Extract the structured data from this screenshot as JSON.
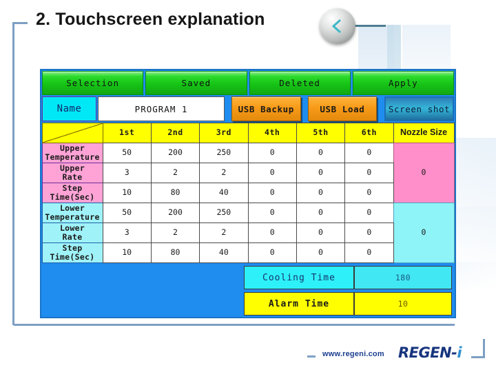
{
  "slide": {
    "title": "2. Touchscreen explanation",
    "nav_back_icon": "chevron-left-icon"
  },
  "footer": {
    "url": "www.regeni.com",
    "logo_main": "REGEN-",
    "logo_accent": "i"
  },
  "hmi": {
    "tabs": [
      {
        "label": "Selection"
      },
      {
        "label": "Saved"
      },
      {
        "label": "Deleted"
      },
      {
        "label": "Apply"
      }
    ],
    "name_row": {
      "label": "Name",
      "value": "PROGRAM 1",
      "usb_backup": "USB Backup",
      "usb_load": "USB Load",
      "screen_shot": "Screen shot"
    },
    "table": {
      "columns": [
        "1st",
        "2nd",
        "3rd",
        "4th",
        "5th",
        "6th"
      ],
      "nozzle_header": "Nozzle Size",
      "rows": [
        {
          "label": "Upper\nTemperature",
          "group": "upper",
          "values": [
            "50",
            "200",
            "250",
            "0",
            "0",
            "0"
          ]
        },
        {
          "label": "Upper\nRate",
          "group": "upper",
          "values": [
            "3",
            "2",
            "2",
            "0",
            "0",
            "0"
          ]
        },
        {
          "label": "Step\nTime(Sec)",
          "group": "upper",
          "values": [
            "10",
            "80",
            "40",
            "0",
            "0",
            "0"
          ]
        },
        {
          "label": "Lower\nTemperature",
          "group": "lower",
          "values": [
            "50",
            "200",
            "250",
            "0",
            "0",
            "0"
          ]
        },
        {
          "label": "Lower\nRate",
          "group": "lower",
          "values": [
            "3",
            "2",
            "2",
            "0",
            "0",
            "0"
          ]
        },
        {
          "label": "Step\nTime(Sec)",
          "group": "lower",
          "values": [
            "10",
            "80",
            "40",
            "0",
            "0",
            "0"
          ]
        }
      ],
      "nozzle_upper_value": "0",
      "nozzle_lower_value": "0"
    },
    "bottom": {
      "cooling_label": "Cooling Time",
      "cooling_value": "180",
      "alarm_label": "Alarm Time",
      "alarm_value": "10"
    }
  }
}
